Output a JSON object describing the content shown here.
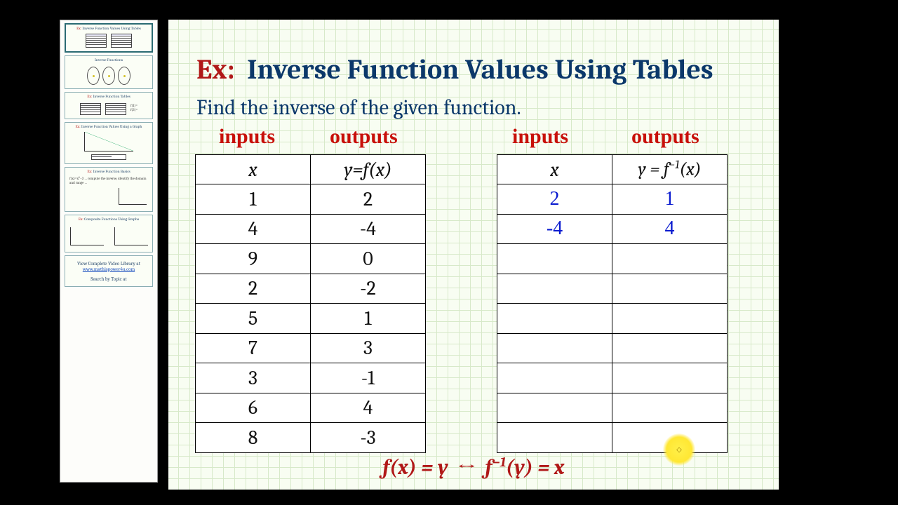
{
  "heading": {
    "ex": "Ex:",
    "title": "Inverse Function Values Using Tables"
  },
  "subtitle": "Find the inverse of the given function.",
  "annotations": {
    "inputs": "inputs",
    "outputs": "outputs"
  },
  "left_table": {
    "headers": {
      "x": "x",
      "y": "y=f(x)"
    },
    "rows": [
      {
        "x": "1",
        "y": "2"
      },
      {
        "x": "4",
        "y": "-4"
      },
      {
        "x": "9",
        "y": "0"
      },
      {
        "x": "2",
        "y": "-2"
      },
      {
        "x": "5",
        "y": "1"
      },
      {
        "x": "7",
        "y": "3"
      },
      {
        "x": "3",
        "y": "-1"
      },
      {
        "x": "6",
        "y": "4"
      },
      {
        "x": "8",
        "y": "-3"
      }
    ]
  },
  "right_table": {
    "headers": {
      "x": "x",
      "y": "y = f⁻¹(x)"
    },
    "rows": [
      {
        "x": "2",
        "y": "1"
      },
      {
        "x": "-4",
        "y": "4"
      },
      {
        "x": "",
        "y": ""
      },
      {
        "x": "",
        "y": ""
      },
      {
        "x": "",
        "y": ""
      },
      {
        "x": "",
        "y": ""
      },
      {
        "x": "",
        "y": ""
      },
      {
        "x": "",
        "y": ""
      },
      {
        "x": "",
        "y": ""
      }
    ]
  },
  "bottom_eq": "f(x) = y   ↔   f⁻¹(y) = x",
  "sidebar": {
    "thumbs": [
      {
        "title_ex": "Ex:",
        "title": "Inverse Function Values Using Tables"
      },
      {
        "title_ex": "",
        "title": "Inverse Functions"
      },
      {
        "title_ex": "Ex:",
        "title": "Inverse Function Tables"
      },
      {
        "title_ex": "Ex:",
        "title": "Inverse Function Values Using a Graph"
      },
      {
        "title_ex": "Ex:",
        "title": "Inverse Function Basics"
      },
      {
        "title_ex": "Ex:",
        "title": "Composite Functions Using Graphs"
      }
    ],
    "footer": {
      "line1": "View Complete Video Library at",
      "link": "www.mathispower4u.com",
      "line2": "Search by Topic at"
    }
  }
}
